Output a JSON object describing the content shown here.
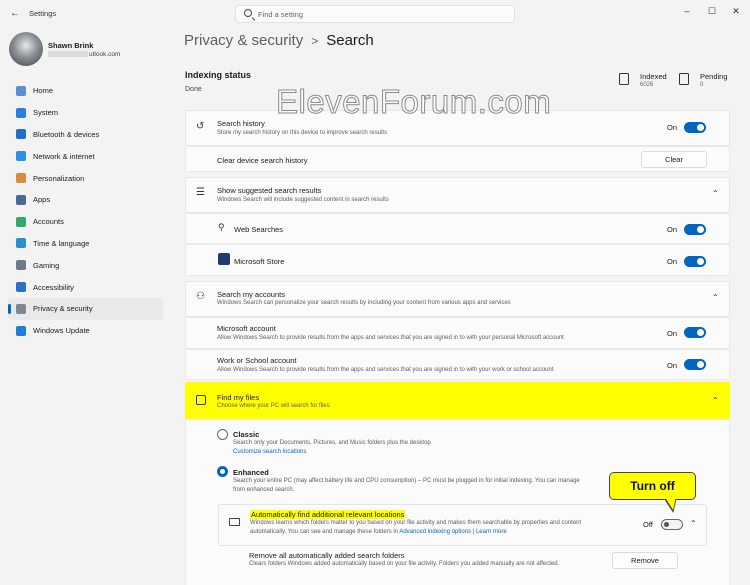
{
  "window": {
    "title": "Settings",
    "minimize": "–",
    "maximize": "☐",
    "close": "✕"
  },
  "search": {
    "placeholder": "Find a setting"
  },
  "user": {
    "name": "Shawn Brink",
    "email": "utlook.com"
  },
  "nav": {
    "items": [
      {
        "label": "Home",
        "icon": "home-icon",
        "color": "#5a8fd6"
      },
      {
        "label": "System",
        "icon": "system-icon",
        "color": "#2a7de1"
      },
      {
        "label": "Bluetooth & devices",
        "icon": "bluetooth-icon",
        "color": "#1f6fd1"
      },
      {
        "label": "Network & internet",
        "icon": "wifi-icon",
        "color": "#2f8fe6"
      },
      {
        "label": "Personalization",
        "icon": "brush-icon",
        "color": "#d98a3d"
      },
      {
        "label": "Apps",
        "icon": "apps-icon",
        "color": "#4a6a9a"
      },
      {
        "label": "Accounts",
        "icon": "accounts-icon",
        "color": "#2faa6a"
      },
      {
        "label": "Time & language",
        "icon": "globe-icon",
        "color": "#2a8fd0"
      },
      {
        "label": "Gaming",
        "icon": "gamepad-icon",
        "color": "#6c7a89"
      },
      {
        "label": "Accessibility",
        "icon": "accessibility-icon",
        "color": "#2a6fc9"
      },
      {
        "label": "Privacy & security",
        "icon": "shield-icon",
        "color": "#7d8792"
      },
      {
        "label": "Windows Update",
        "icon": "update-icon",
        "color": "#1f7fd8"
      }
    ]
  },
  "breadcrumb": {
    "parent": "Privacy & security",
    "separator": ">",
    "current": "Search"
  },
  "indexing": {
    "title": "Indexing status",
    "state": "Done",
    "indexed_label": "Indexed",
    "indexed_value": "6026",
    "pending_label": "Pending",
    "pending_value": "0"
  },
  "watermark": "ElevenForum.com",
  "search_history": {
    "title": "Search history",
    "desc": "Store my search history on this device to improve search results",
    "state": "On",
    "clear_title": "Clear device search history",
    "clear_button": "Clear"
  },
  "suggested": {
    "title": "Show suggested search results",
    "desc": "Windows Search will include suggested content in search results",
    "web_label": "Web Searches",
    "web_state": "On",
    "store_label": "Microsoft Store",
    "store_state": "On"
  },
  "my_accounts": {
    "title": "Search my accounts",
    "desc": "Windows Search can personalize your search results by including your content from various apps and services",
    "ms_title": "Microsoft account",
    "ms_desc": "Allow Windows Search to provide results from the apps and services that you are signed in to with your personal Microsoft account",
    "ms_state": "On",
    "work_title": "Work or School account",
    "work_desc": "Allow Windows Search to provide results from the apps and services that you are signed in to with your work or school account",
    "work_state": "On"
  },
  "find_files": {
    "title": "Find my files",
    "desc": "Choose where your PC will search for files",
    "classic_title": "Classic",
    "classic_desc": "Search only your Documents, Pictures, and Music folders plus the desktop",
    "classic_link": "Customize search locations",
    "enhanced_title": "Enhanced",
    "enhanced_desc_1": "Search your entire PC (may affect battery life and CPU consumption) – PC must be plugged in for initial indexing. You can manage",
    "enhanced_desc_2": "from enhanced search.",
    "auto_title": "Automatically find additional relevant locations",
    "auto_desc_1": "Windows learns which folders matter to you based on your file activity and makes them searchable by properties and content",
    "auto_desc_2": "automatically. You can see and manage these folders in",
    "auto_link_1": "Advanced indexing options",
    "auto_sep": "|",
    "auto_link_2": "Learn more",
    "auto_state": "Off",
    "remove_title": "Remove all automatically added search folders",
    "remove_desc": "Clears folders Windows added automatically based on your file activity. Folders you added manually are not affected.",
    "remove_button": "Remove"
  },
  "callout": {
    "text": "Turn off"
  },
  "colors": {
    "accent": "#0067c0",
    "highlight": "#ffff00"
  }
}
